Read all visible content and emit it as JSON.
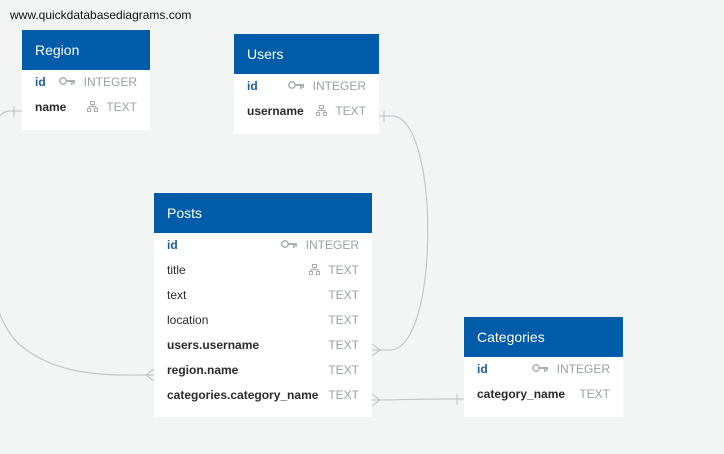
{
  "watermark": "www.quickdatabasediagrams.com",
  "tables": {
    "region": {
      "title": "Region",
      "rows": [
        {
          "name": "id",
          "type": "INTEGER",
          "icon": "key-icon"
        },
        {
          "name": "name",
          "type": "TEXT",
          "icon": "index-icon"
        }
      ]
    },
    "users": {
      "title": "Users",
      "rows": [
        {
          "name": "id",
          "type": "INTEGER",
          "icon": "key-icon"
        },
        {
          "name": "username",
          "type": "TEXT",
          "icon": "index-icon"
        }
      ]
    },
    "posts": {
      "title": "Posts",
      "rows": [
        {
          "name": "id",
          "type": "INTEGER",
          "icon": "key-icon"
        },
        {
          "name": "title",
          "type": "TEXT",
          "icon": "index-icon"
        },
        {
          "name": "text",
          "type": "TEXT"
        },
        {
          "name": "location",
          "type": "TEXT"
        },
        {
          "name": "users.username",
          "type": "TEXT"
        },
        {
          "name": "region.name",
          "type": "TEXT"
        },
        {
          "name": "categories.category_name",
          "type": "TEXT"
        }
      ]
    },
    "categories": {
      "title": "Categories",
      "rows": [
        {
          "name": "id",
          "type": "INTEGER",
          "icon": "key-icon"
        },
        {
          "name": "category_name",
          "type": "TEXT"
        }
      ]
    }
  },
  "colors": {
    "header": "#005ba8",
    "pk_text": "#1a5d99",
    "type_text": "#9aa0a5",
    "connector": "#c4c7ca",
    "background": "#f3f5f5"
  }
}
